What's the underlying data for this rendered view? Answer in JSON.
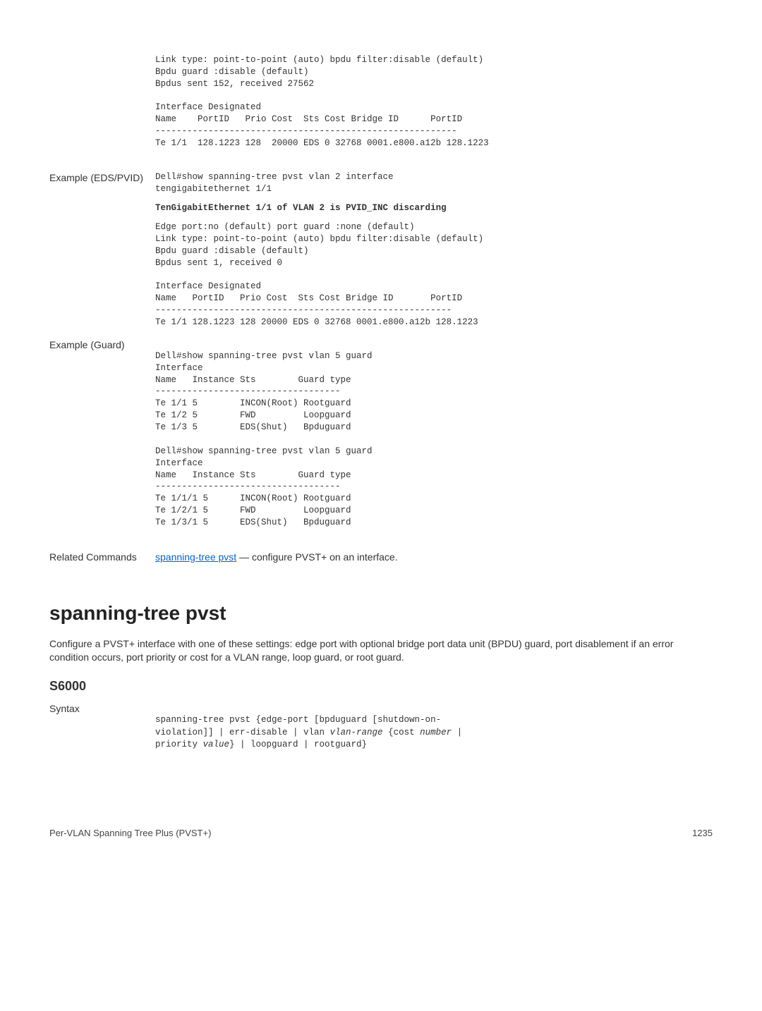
{
  "block1": {
    "l1": "Link type: point-to-point (auto) bpdu filter:disable (default)",
    "l2": "Bpdu guard :disable (default)",
    "l3": "Bpdus sent 152, received 27562",
    "l4": "Interface Designated",
    "l5": "Name    PortID   Prio Cost  Sts Cost Bridge ID      PortID",
    "l6": "---------------------------------------------------------",
    "l7": "Te 1/1  128.1223 128  20000 EDS 0 32768 0001.e800.a12b 128.1223"
  },
  "example_eds": {
    "label": "Example (EDS/PVID)",
    "l1": "Dell#show spanning-tree pvst vlan 2 interface",
    "l2": "tengigabitethernet 1/1",
    "bold": "TenGigabitEthernet 1/1 of VLAN 2 is PVID_INC discarding",
    "l3": "Edge port:no (default) port guard :none (default)",
    "l4": "Link type: point-to-point (auto) bpdu filter:disable (default)",
    "l5": "Bpdu guard :disable (default)",
    "l6": "Bpdus sent 1, received 0",
    "l7": "Interface Designated",
    "l8": "Name   PortID   Prio Cost  Sts Cost Bridge ID       PortID",
    "l9": "--------------------------------------------------------",
    "l10": "Te 1/1 128.1223 128 20000 EDS 0 32768 0001.e800.a12b 128.1223"
  },
  "example_guard": {
    "label": "Example (Guard)",
    "l1": "Dell#show spanning-tree pvst vlan 5 guard",
    "l2": "Interface",
    "l3": "Name   Instance Sts        Guard type",
    "l4": "-----------------------------------",
    "l5": "Te 1/1 5        INCON(Root) Rootguard",
    "l6": "Te 1/2 5        FWD         Loopguard",
    "l7": "Te 1/3 5        EDS(Shut)   Bpduguard",
    "l8": "Dell#show spanning-tree pvst vlan 5 guard",
    "l9": "Interface",
    "l10": "Name   Instance Sts        Guard type",
    "l11": "-----------------------------------",
    "l12": "Te 1/1/1 5      INCON(Root) Rootguard",
    "l13": "Te 1/2/1 5      FWD         Loopguard",
    "l14": "Te 1/3/1 5      EDS(Shut)   Bpduguard"
  },
  "related": {
    "label": "Related Commands",
    "link": "spanning-tree pvst",
    "text": " — configure PVST+ on an interface."
  },
  "heading": "spanning-tree pvst",
  "intro": "Configure a PVST+ interface with one of these settings: edge port with optional bridge port data unit (BPDU) guard, port disablement if an error condition occurs, port priority or cost for a VLAN range, loop guard, or root guard.",
  "s6000": "S6000",
  "syntax": {
    "label": "Syntax",
    "p1": "spanning-tree pvst {edge-port [bpduguard [shutdown-on-",
    "p2": "violation]] | err-disable | vlan ",
    "p2i": "vlan-range",
    "p2b": " {cost ",
    "p2c": "number",
    "p2d": " |",
    "p3": "priority ",
    "p3i": "value",
    "p3b": "} | loopguard | rootguard}"
  },
  "footer": {
    "left": "Per-VLAN Spanning Tree Plus (PVST+)",
    "right": "1235"
  }
}
